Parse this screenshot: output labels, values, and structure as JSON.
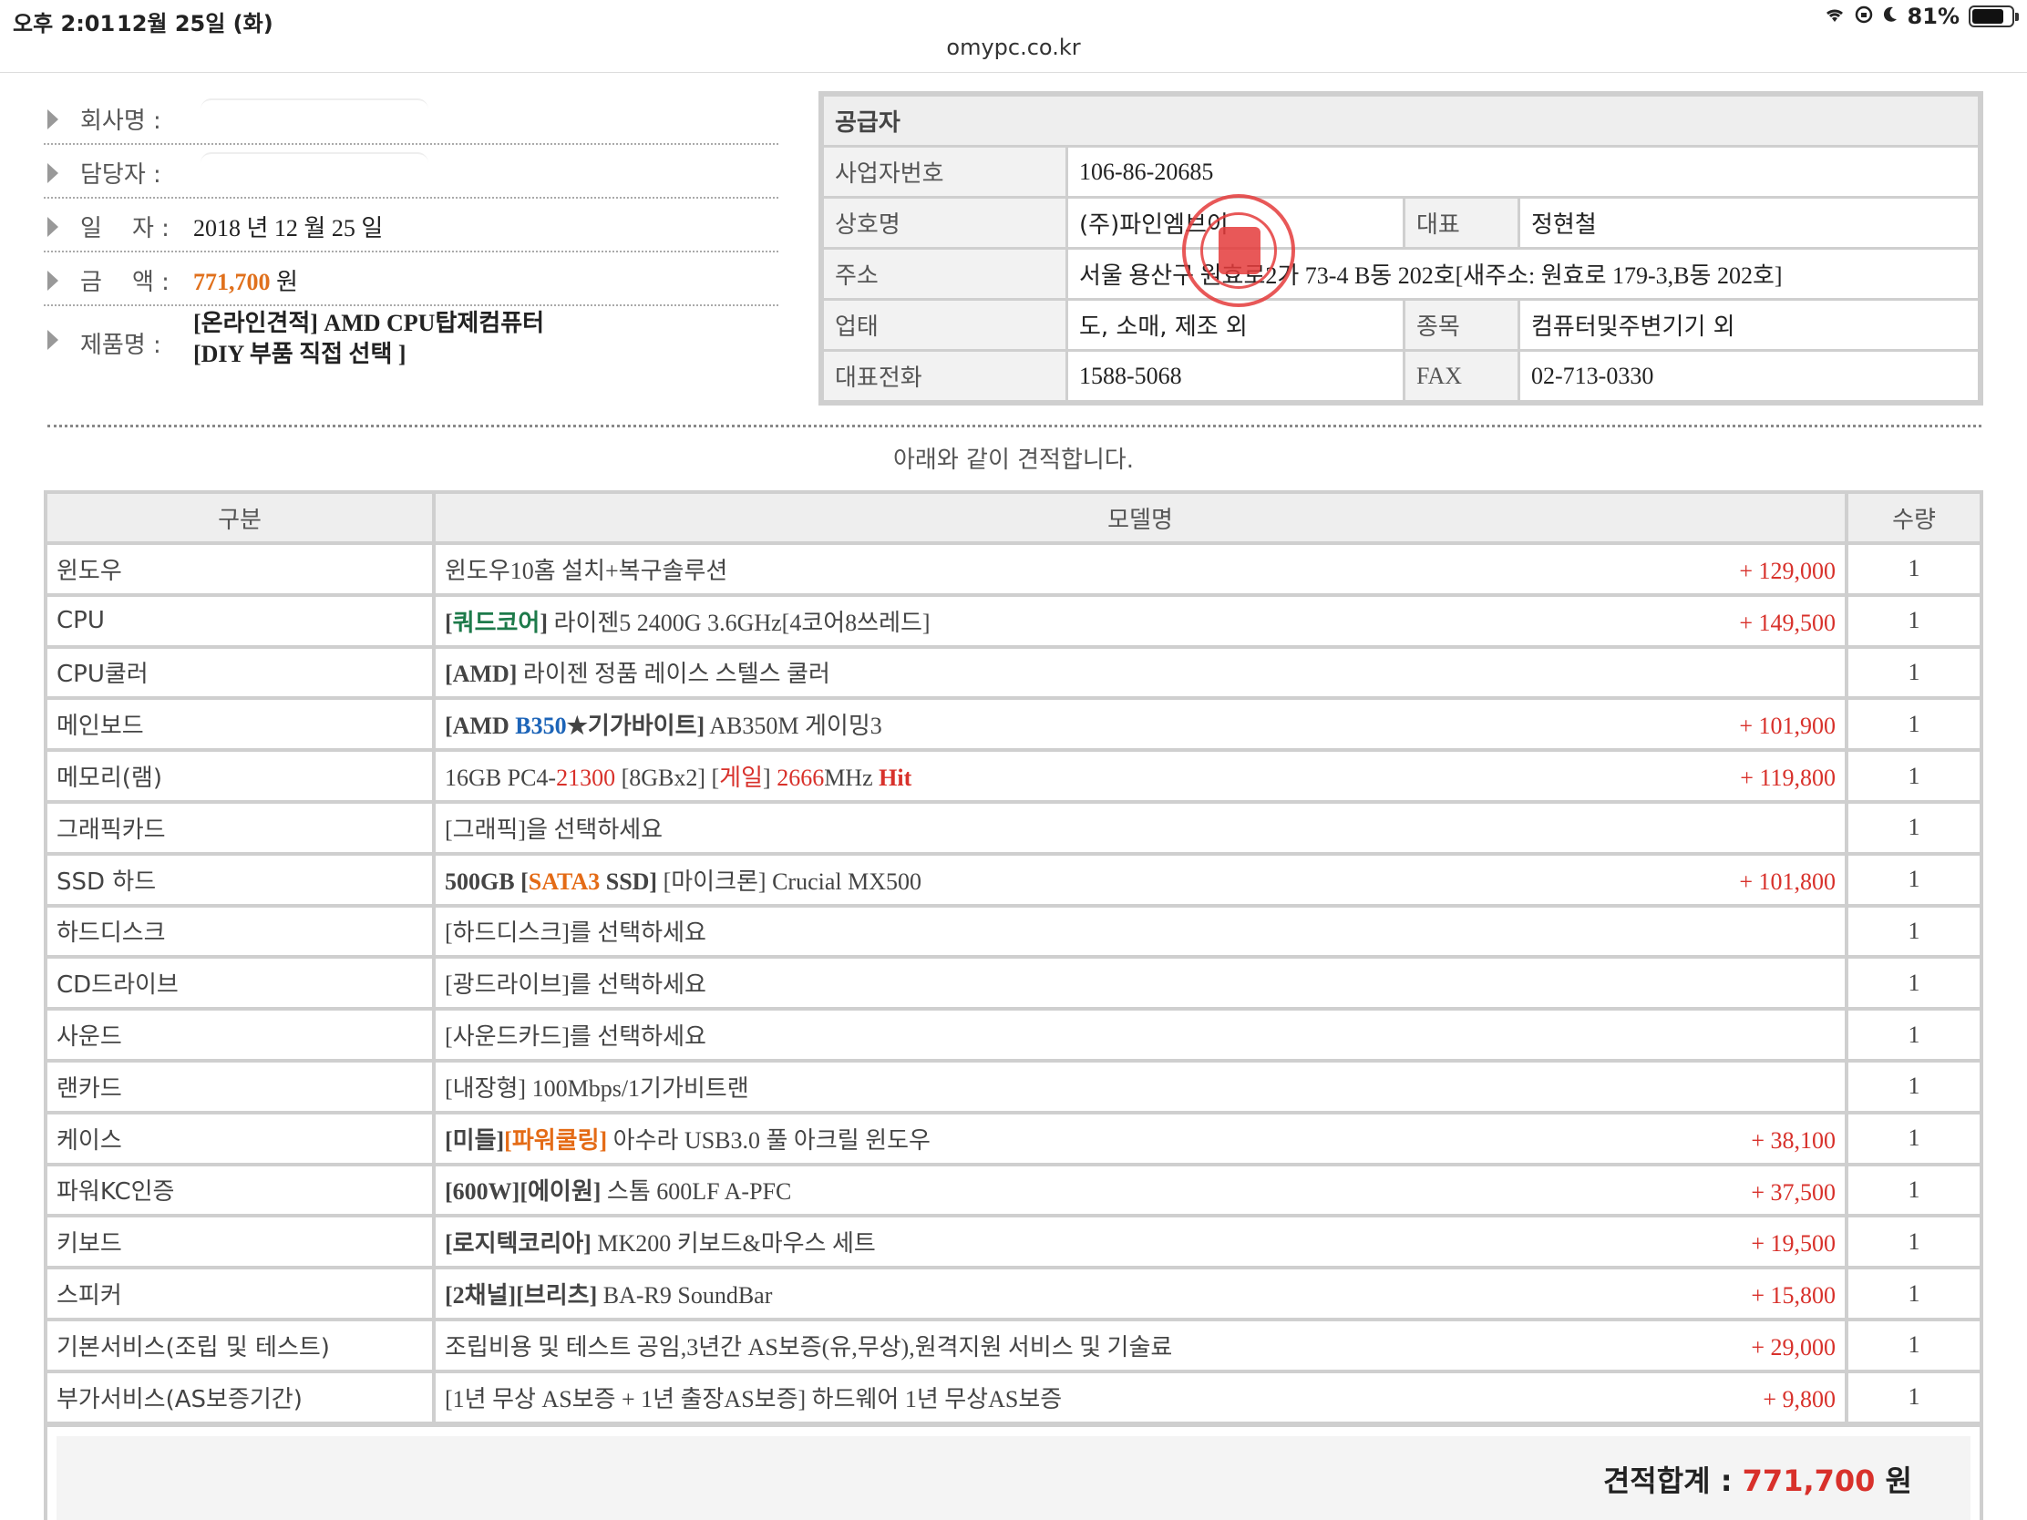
{
  "status": {
    "time": "오후 2:01",
    "date": "12월 25일 (화)",
    "battery": "81%",
    "battery_fraction": 0.81
  },
  "browser": {
    "url": "omypc.co.kr"
  },
  "customer": {
    "company_label": "회사명 :",
    "contact_label": "담당자 :",
    "date_label": "일    자 :",
    "date_value": "2018 년 12 월 25 일",
    "amount_label": "금    액 :",
    "amount_value": "771,700",
    "amount_unit": "원",
    "product_label": "제품명 :",
    "product_line1": "[온라인견적] AMD CPU탑제컴퓨터",
    "product_line2": "[DIY 부품 직접 선택 ]"
  },
  "supplier": {
    "header": "공급자",
    "reg_label": "사업자번호",
    "reg_value": "106-86-20685",
    "name_label": "상호명",
    "name_value": "(주)파인엠브이",
    "rep_label": "대표",
    "rep_value": "정현철",
    "addr_label": "주소",
    "addr_value": "서울 용산구 원효로2가 73-4 B동 202호[새주소: 원효로 179-3,B동 202호]",
    "biz_label": "업태",
    "biz_value": "도, 소매, 제조 외",
    "item_label": "종목",
    "item_value": "컴퓨터및주변기기 외",
    "tel_label": "대표전화",
    "tel_value": "1588-5068",
    "fax_label": "FAX",
    "fax_value": "02-713-0330"
  },
  "notice": "아래와 같이 견적합니다.",
  "table": {
    "headers": {
      "category": "구분",
      "model": "모델명",
      "qty": "수량"
    },
    "rows": [
      {
        "cat": "윈도우",
        "parts": [
          {
            "t": "윈도우10홈 설치+복구솔루션",
            "c": ""
          }
        ],
        "price": "+ 129,000",
        "qty": "1"
      },
      {
        "cat": "CPU",
        "parts": [
          {
            "t": "[",
            "c": "b"
          },
          {
            "t": "쿼드코어",
            "c": "green"
          },
          {
            "t": "]",
            "c": "b"
          },
          {
            "t": " 라이젠5 2400G 3.6GHz[4코어8쓰레드]",
            "c": ""
          }
        ],
        "price": "+ 149,500",
        "qty": "1"
      },
      {
        "cat": "CPU쿨러",
        "parts": [
          {
            "t": "[AMD]",
            "c": "b"
          },
          {
            "t": " 라이젠 정품 레이스 스텔스 쿨러",
            "c": ""
          }
        ],
        "price": "",
        "qty": "1"
      },
      {
        "cat": "메인보드",
        "parts": [
          {
            "t": "[AMD ",
            "c": "b"
          },
          {
            "t": "B350",
            "c": "blue"
          },
          {
            "t": "★기가바이트]",
            "c": "b"
          },
          {
            "t": " AB350M 게이밍3",
            "c": ""
          }
        ],
        "price": "+ 101,900",
        "qty": "1"
      },
      {
        "cat": "메모리(램)",
        "parts": [
          {
            "t": "16GB PC4-",
            "c": ""
          },
          {
            "t": "21300",
            "c": "red"
          },
          {
            "t": " [8GBx2] [",
            "c": ""
          },
          {
            "t": "게일",
            "c": "red"
          },
          {
            "t": "] ",
            "c": ""
          },
          {
            "t": "2666",
            "c": "red"
          },
          {
            "t": "MHz ",
            "c": ""
          },
          {
            "t": "Hit",
            "c": "redb"
          }
        ],
        "price": "+ 119,800",
        "qty": "1"
      },
      {
        "cat": "그래픽카드",
        "parts": [
          {
            "t": "[그래픽]을 선택하세요",
            "c": ""
          }
        ],
        "price": "",
        "qty": "1"
      },
      {
        "cat": "SSD 하드",
        "parts": [
          {
            "t": "500GB [",
            "c": "b"
          },
          {
            "t": "SATA3",
            "c": "orange"
          },
          {
            "t": " SSD]",
            "c": "b"
          },
          {
            "t": " [마이크론] Crucial MX500",
            "c": ""
          }
        ],
        "price": "+ 101,800",
        "qty": "1"
      },
      {
        "cat": "하드디스크",
        "parts": [
          {
            "t": "[하드디스크]를 선택하세요",
            "c": ""
          }
        ],
        "price": "",
        "qty": "1"
      },
      {
        "cat": "CD드라이브",
        "parts": [
          {
            "t": "[광드라이브]를 선택하세요",
            "c": ""
          }
        ],
        "price": "",
        "qty": "1"
      },
      {
        "cat": "사운드",
        "parts": [
          {
            "t": "[사운드카드]를 선택하세요",
            "c": ""
          }
        ],
        "price": "",
        "qty": "1"
      },
      {
        "cat": "랜카드",
        "parts": [
          {
            "t": "[내장형] 100Mbps/1기가비트랜",
            "c": ""
          }
        ],
        "price": "",
        "qty": "1"
      },
      {
        "cat": "케이스",
        "parts": [
          {
            "t": "[미들]",
            "c": "b"
          },
          {
            "t": "[파워쿨링]",
            "c": "orange"
          },
          {
            "t": " 아수라 USB3.0 풀 아크릴 윈도우",
            "c": ""
          }
        ],
        "price": "+ 38,100",
        "qty": "1"
      },
      {
        "cat": "파워KC인증",
        "parts": [
          {
            "t": "[600W][에이원]",
            "c": "b"
          },
          {
            "t": " 스톰 600LF A-PFC",
            "c": ""
          }
        ],
        "price": "+ 37,500",
        "qty": "1"
      },
      {
        "cat": "키보드",
        "parts": [
          {
            "t": "[로지텍코리아]",
            "c": "b"
          },
          {
            "t": " MK200 키보드&마우스 세트",
            "c": ""
          }
        ],
        "price": "+ 19,500",
        "qty": "1"
      },
      {
        "cat": "스피커",
        "parts": [
          {
            "t": "[2채널][브리츠]",
            "c": "b"
          },
          {
            "t": " BA-R9 SoundBar",
            "c": ""
          }
        ],
        "price": "+ 15,800",
        "qty": "1"
      },
      {
        "cat": "기본서비스(조립 및 테스트)",
        "parts": [
          {
            "t": "조립비용 및 테스트 공임,3년간 AS보증(유,무상),원격지원 서비스 및 기술료",
            "c": ""
          }
        ],
        "price": "+ 29,000",
        "qty": "1"
      },
      {
        "cat": "부가서비스(AS보증기간)",
        "parts": [
          {
            "t": "[1년 무상 AS보증 + 1년 출장AS보증] 하드웨어 1년 무상AS보증",
            "c": ""
          }
        ],
        "price": "+ 9,800",
        "qty": "1"
      }
    ]
  },
  "total": {
    "label": "견적합계 :",
    "value": "771,700",
    "unit": "원"
  },
  "colors": {
    "accent_red": "#d8312b",
    "accent_orange": "#e46b16",
    "border": "#cfcfcf",
    "header_bg": "#eeeeee"
  }
}
